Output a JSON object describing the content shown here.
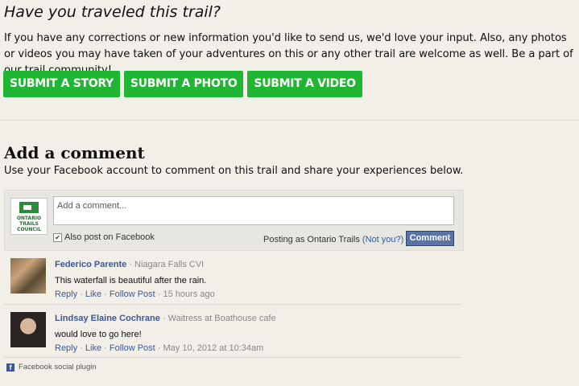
{
  "trail_section": {
    "heading": "Have you traveled this trail?",
    "intro": "If you have any corrections or new information you'd like to send us, we'd love your input. Also, any photos or videos you may have taken of your adventures on this or any other trail are welcome as well. Be a part of our trail community!",
    "buttons": [
      "SUBMIT A STORY",
      "SUBMIT A PHOTO",
      "SUBMIT A VIDEO"
    ]
  },
  "comments_section": {
    "title": "Add a comment",
    "subtitle": "Use your Facebook account to comment on this trail and share your experiences below.",
    "logo_text": "ONTARIO TRAILS COUNCIL",
    "input_placeholder": "Add a comment...",
    "also_post_label": "Also post on Facebook",
    "posting_as": "Posting as Ontario Trails",
    "not_you": "(Not you?)",
    "comment_button": "Comment"
  },
  "comments": [
    {
      "name": "Federico Parente",
      "meta": " · Niagara Falls CVI",
      "text": "This waterfall is beautiful after the rain.",
      "reply": "Reply",
      "like": "Like",
      "follow": "Follow Post",
      "time": "15 hours ago"
    },
    {
      "name": "Lindsay Elaine Cochrane",
      "meta": " · Waitress at Boathouse cafe",
      "text": "would love to go here!",
      "reply": "Reply",
      "like": "Like",
      "follow": "Follow Post",
      "time": "May 10, 2012 at 10:34am"
    }
  ],
  "plugin_label": "Facebook social plugin",
  "colors": {
    "button_green": "#20b532",
    "facebook_blue": "#3b5998",
    "background": "#f1efe8"
  },
  "icons": {
    "checkbox": "checkmark-icon",
    "plugin": "facebook-icon"
  }
}
